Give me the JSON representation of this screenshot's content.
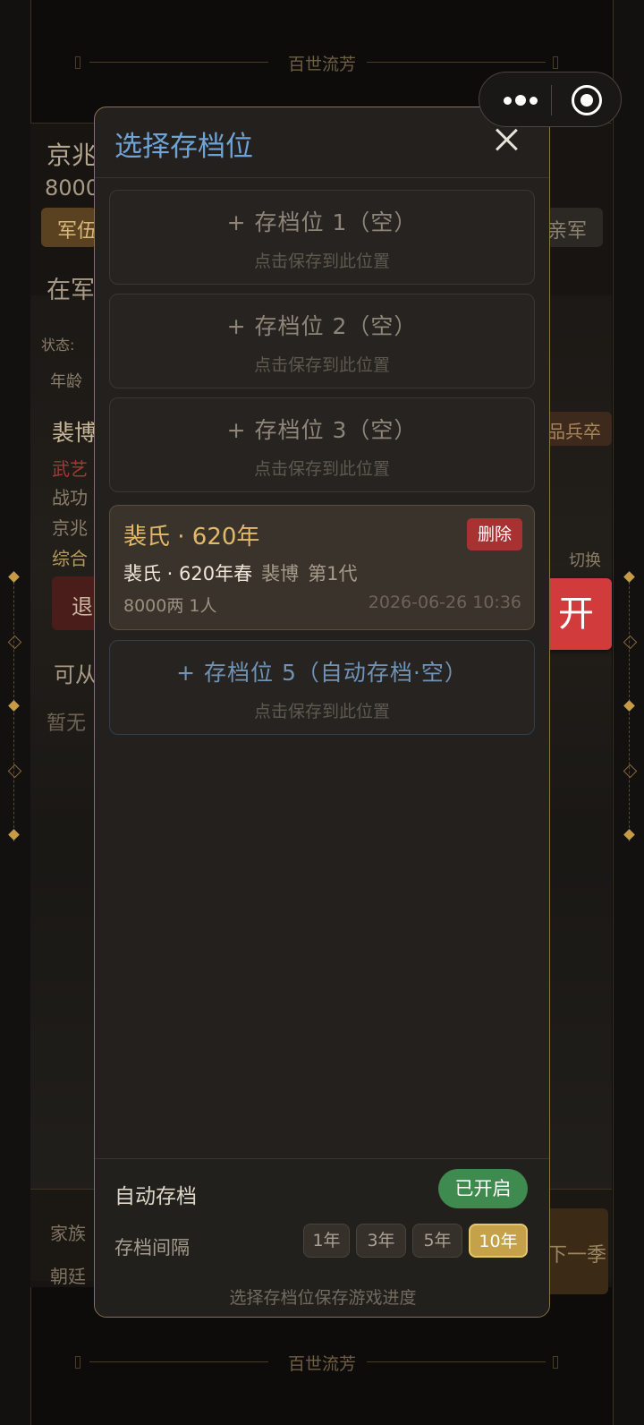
{
  "banner": {
    "title": "百世流芳"
  },
  "background": {
    "location": "京兆",
    "money": "8000",
    "tab_army": "军伍",
    "tab_guard": "亲军",
    "at_army": "在军",
    "status_label": "状态:",
    "age_label": "年龄",
    "person_name": "裴博",
    "skill_martial": "武艺",
    "merit": "战功",
    "jingzhao": "京兆",
    "overall": "综合",
    "retire": "退",
    "can_from": "可从",
    "none_yet": "暂无",
    "rank_soldier": "品兵卒",
    "switch": "切换",
    "family": "家族",
    "court": "朝廷",
    "next_season": "下一季"
  },
  "capsule": {
    "more_icon": "more-dots-icon",
    "target_icon": "target-icon"
  },
  "open_button": {
    "label": "开"
  },
  "modal": {
    "title": "选择存档位",
    "slots": [
      {
        "title": "+  存档位 1（空）",
        "hint": "点击保存到此位置"
      },
      {
        "title": "+  存档位 2（空）",
        "hint": "点击保存到此位置"
      },
      {
        "title": "+  存档位 3（空）",
        "hint": "点击保存到此位置"
      }
    ],
    "filled_slot": {
      "title": "裴氏 · 620年",
      "delete_label": "删除",
      "line2_main": "裴氏 · 620年春",
      "line2_name": "裴博",
      "line2_gen": "第1代",
      "money_people": "8000两  1人",
      "timestamp": "2026-06-26 10:36"
    },
    "auto_slot": {
      "title": "+  存档位 5（自动存档·空）",
      "hint": "点击保存到此位置"
    },
    "footer": {
      "auto_label": "自动存档",
      "auto_status": "已开启",
      "interval_label": "存档间隔",
      "intervals": [
        "1年",
        "3年",
        "5年",
        "10年"
      ],
      "selected_interval": "10年",
      "hint": "选择存档位保存游戏进度"
    }
  },
  "colors": {
    "title_blue": "#6fa3d8",
    "gold": "#e2b869",
    "delete_red": "#a83232",
    "toggle_green": "#3f8a4f",
    "active_gold": "#c5a24a",
    "open_red": "#d13b3b"
  }
}
